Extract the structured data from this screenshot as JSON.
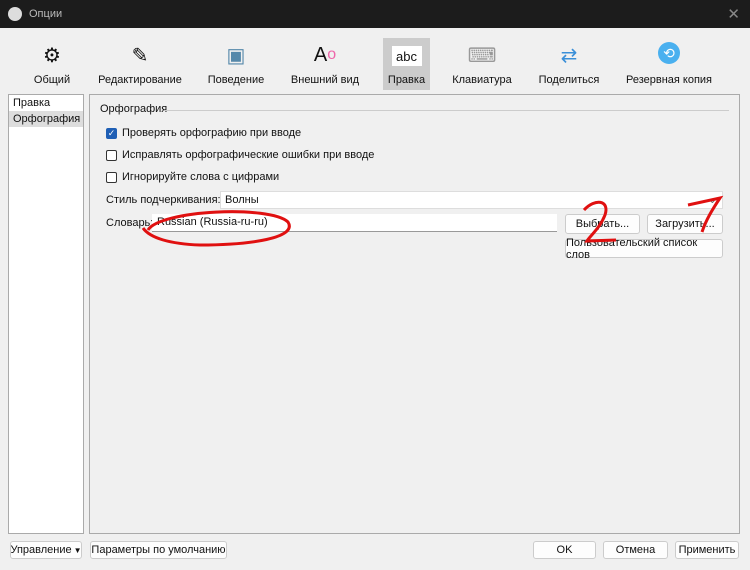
{
  "window": {
    "title": "Опции"
  },
  "toolbar": [
    {
      "label": "Общий",
      "icon": "gears-icon"
    },
    {
      "label": "Редактирование",
      "icon": "pencil-icon"
    },
    {
      "label": "Поведение",
      "icon": "window-gear-icon"
    },
    {
      "label": "Внешний вид",
      "icon": "font-icon"
    },
    {
      "label": "Правка",
      "icon": "abc-icon"
    },
    {
      "label": "Клавиатура",
      "icon": "keyboard-icon"
    },
    {
      "label": "Поделиться",
      "icon": "share-icon"
    },
    {
      "label": "Резервная копия",
      "icon": "backup-icon"
    }
  ],
  "toolbar_icons": {
    "abc": "abc"
  },
  "sidebar": [
    "Правка",
    "Орфография"
  ],
  "group": {
    "title": "Орфография",
    "checkboxes": [
      {
        "label": "Проверять орфографию при вводе",
        "checked": true
      },
      {
        "label": "Исправлять орфографические ошибки при вводе",
        "checked": false
      },
      {
        "label": "Игнорируйте слова с цифрами",
        "checked": false
      }
    ],
    "underline_label": "Стиль подчеркивания:",
    "underline_value": "Волны",
    "dict_label": "Словарь:",
    "dict_value": "Russian (Russia-ru-ru)",
    "choose": "Выбрать...",
    "load": "Загрузить...",
    "user_words": "Пользовательский список слов"
  },
  "footer": {
    "manage": "Управление",
    "defaults": "Параметры по умолчанию",
    "ok": "OK",
    "cancel": "Отмена",
    "apply": "Применить"
  }
}
